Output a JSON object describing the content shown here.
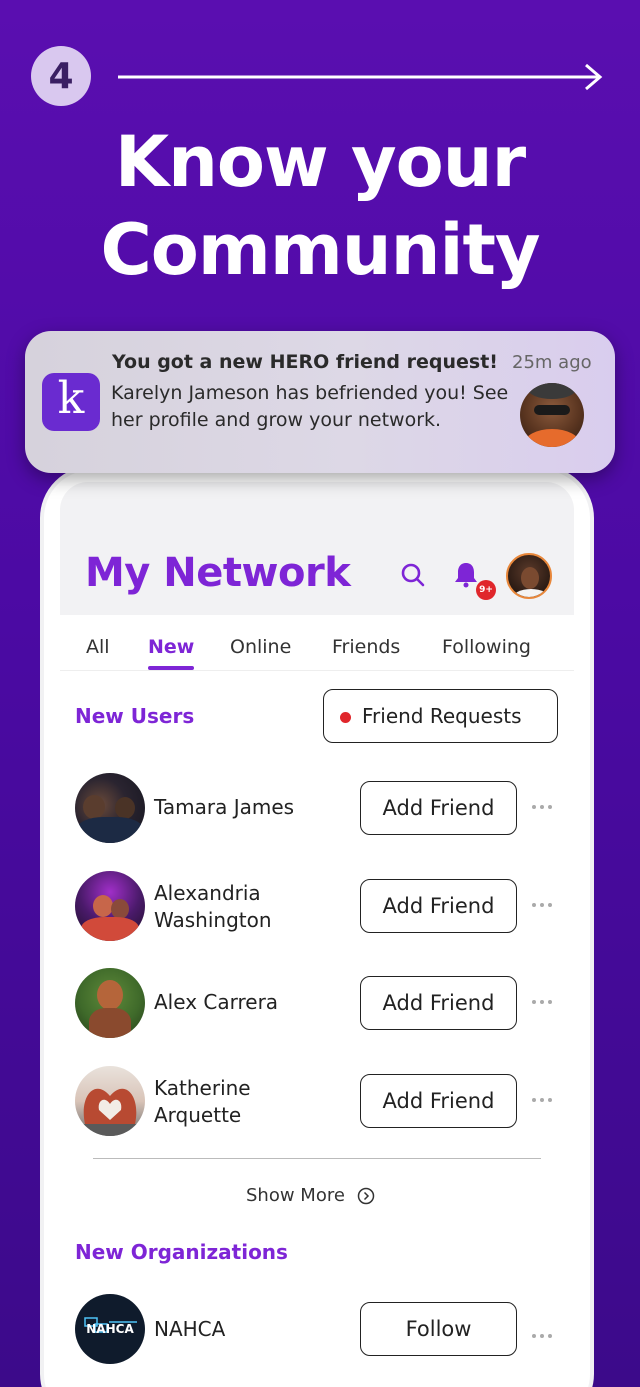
{
  "promo": {
    "step_number": "4",
    "headline_line1": "Know your",
    "headline_line2": "Community"
  },
  "notification": {
    "logo_letter": "k",
    "title": "You got a new HERO friend request!",
    "time": "25m ago",
    "body": "Karelyn Jameson has befriended you! See her profile and grow your network."
  },
  "app": {
    "title": "My Network",
    "badge_count": "9+",
    "tabs": [
      {
        "label": "All"
      },
      {
        "label": "New"
      },
      {
        "label": "Online"
      },
      {
        "label": "Friends"
      },
      {
        "label": "Following"
      }
    ],
    "active_tab": "New",
    "new_users_label": "New Users",
    "friend_requests_label": "Friend Requests",
    "users": [
      {
        "name": "Tamara James",
        "action": "Add Friend"
      },
      {
        "name": "Alexandria Washington",
        "action": "Add Friend"
      },
      {
        "name": "Alex Carrera",
        "action": "Add Friend"
      },
      {
        "name": "Katherine Arquette",
        "action": "Add Friend"
      }
    ],
    "show_more": "Show More",
    "new_orgs_label": "New Organizations",
    "orgs": [
      {
        "name": "NAHCA",
        "action": "Follow",
        "logo_text": "NAHCA"
      }
    ],
    "colors": {
      "accent": "#7e25d6",
      "background": "#4b0aa3",
      "badge": "#e0262b"
    }
  }
}
